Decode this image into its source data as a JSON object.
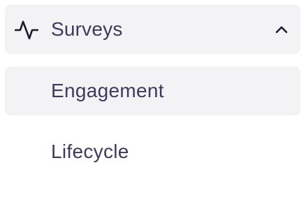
{
  "nav": {
    "group": {
      "label": "Surveys",
      "icon": "activity-pulse-icon",
      "expanded": true,
      "chevron_icon": "chevron-up-icon"
    },
    "items": [
      {
        "label": "Engagement",
        "active": true
      },
      {
        "label": "Lifecycle",
        "active": false
      }
    ]
  },
  "colors": {
    "text": "#3e3a5e",
    "active_bg": "#f3f3f6",
    "icon": "#1c1a2e"
  }
}
